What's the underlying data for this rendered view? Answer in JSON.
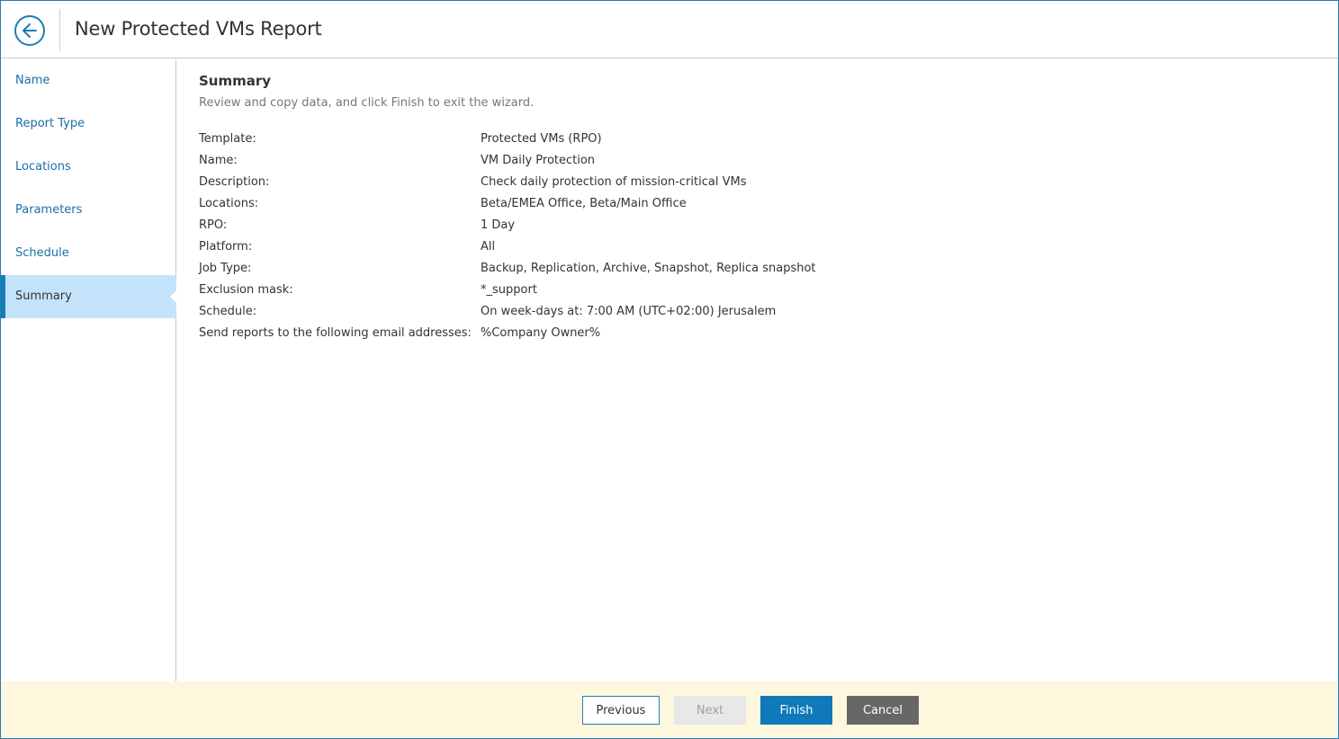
{
  "header": {
    "title": "New Protected VMs Report",
    "back_icon": "arrow-left-icon"
  },
  "sidebar": {
    "steps": [
      {
        "label": "Name"
      },
      {
        "label": "Report Type"
      },
      {
        "label": "Locations"
      },
      {
        "label": "Parameters"
      },
      {
        "label": "Schedule"
      },
      {
        "label": "Summary",
        "active": true
      }
    ]
  },
  "main": {
    "title": "Summary",
    "subtitle": "Review and copy data, and click Finish to exit the wizard.",
    "rows": [
      {
        "key": "Template:",
        "value": "Protected VMs (RPO)"
      },
      {
        "key": "Name:",
        "value": "VM Daily Protection"
      },
      {
        "key": "Description:",
        "value": "Check daily protection of mission-critical VMs"
      },
      {
        "key": "Locations:",
        "value": "Beta/EMEA Office, Beta/Main Office"
      },
      {
        "key": "RPO:",
        "value": "1 Day"
      },
      {
        "key": "Platform:",
        "value": "All"
      },
      {
        "key": "Job Type:",
        "value": "Backup, Replication, Archive, Snapshot, Replica snapshot"
      },
      {
        "key": "Exclusion mask:",
        "value": "*_support"
      },
      {
        "key": "Schedule:",
        "value": "On week-days at: 7:00 AM (UTC+02:00) Jerusalem"
      },
      {
        "key": "Send reports to the following email addresses:",
        "value": "%Company Owner%"
      }
    ]
  },
  "footer": {
    "previous_label": "Previous",
    "next_label": "Next",
    "finish_label": "Finish",
    "cancel_label": "Cancel"
  },
  "colors": {
    "accent": "#0f79b9",
    "active_step_bg": "#c4e3fa",
    "footer_bg": "#fdf8dd",
    "cancel_bg": "#676767"
  }
}
